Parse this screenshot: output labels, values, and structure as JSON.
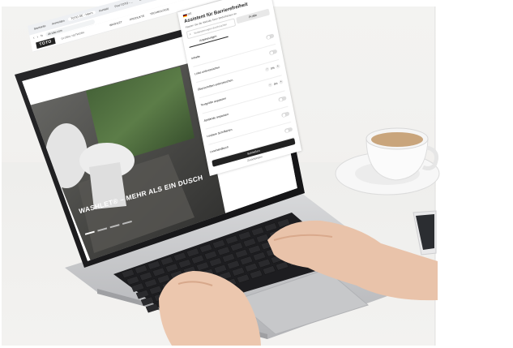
{
  "browser": {
    "tabs": [
      "Startseite",
      "Anmelden",
      "TOTO DE - Intern",
      "Kontakt",
      "Prot TOTO - ...",
      "Google Kalender",
      "Prdt",
      "Jobs",
      "Jobsuche"
    ],
    "address": "de.toto.com"
  },
  "site": {
    "logo": "TOTO",
    "logo_sub": "GLOBAL NETWORK",
    "nav": [
      "WASHLET",
      "PRODUKTE",
      "TECHNOLOGIE"
    ],
    "hero_text": "WASHLET® – MEHR ALS EIN DUSCH",
    "slider_dots": 4
  },
  "accessibility_panel": {
    "language": "DE",
    "title": "Assistent für Barrierefreiheit",
    "subtitle": "Passen Sie die Website Ihren Bedürfnissen an",
    "search_placeholder": "Verbesserungen durchsuchen",
    "tabs": [
      "Anpassungen",
      "Profile"
    ],
    "options": [
      {
        "label": "Inhalte",
        "control": "toggle"
      },
      {
        "label": "Links unterstreichen",
        "control": "toggle"
      },
      {
        "label": "Überschriften unterstreichen",
        "control": "stepper",
        "value": "0%"
      },
      {
        "label": "Textgröße anpassen",
        "control": "stepper",
        "value": "0%"
      },
      {
        "label": "Abstände anpassen",
        "control": "toggle"
      },
      {
        "label": "Lesbare Schriftarten",
        "control": "toggle"
      },
      {
        "label": "Lesehandbuch",
        "control": "toggle"
      }
    ],
    "primary_button": "Schließen",
    "footer_link": "Zurücksetzen"
  },
  "colors": {
    "laptop_body": "#c9cacc",
    "keyboard": "#1c1c1e",
    "panel_button": "#222222",
    "page_bg": "#ffffff"
  }
}
